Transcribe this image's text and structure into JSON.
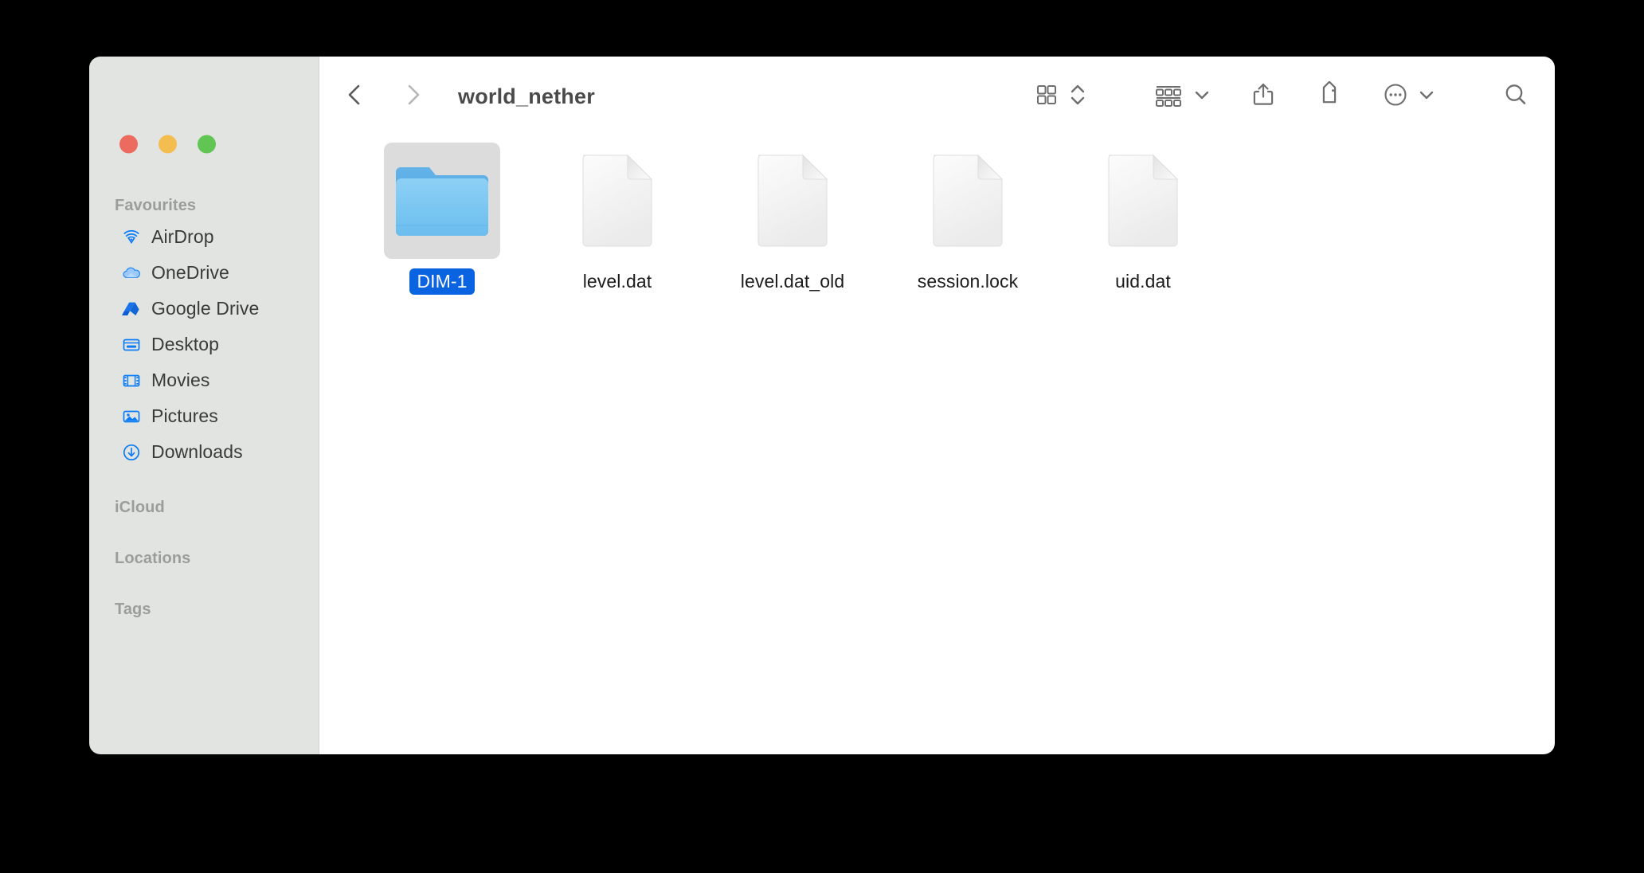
{
  "window": {
    "title": "world_nether",
    "traffic_lights": [
      {
        "name": "close",
        "color": "#ec6a5e"
      },
      {
        "name": "minimize",
        "color": "#f4bd4f"
      },
      {
        "name": "maximize",
        "color": "#61c554"
      }
    ]
  },
  "toolbar": {
    "back_icon": "chevron-left-icon",
    "forward_icon": "chevron-right-icon",
    "view_icon": "icon-view-grid-icon",
    "view_stepper_icon": "chevron-up-down-icon",
    "group_icon": "group-by-icon",
    "group_chevron_icon": "chevron-down-icon",
    "share_icon": "share-icon",
    "tag_icon": "tag-icon",
    "more_icon": "ellipsis-circle-icon",
    "more_chevron_icon": "chevron-down-icon",
    "search_icon": "search-icon"
  },
  "sidebar": {
    "sections": [
      {
        "header": "Favourites",
        "items": [
          {
            "label": "AirDrop",
            "icon": "airdrop-icon"
          },
          {
            "label": "OneDrive",
            "icon": "onedrive-cloud-icon"
          },
          {
            "label": "Google Drive",
            "icon": "google-drive-icon"
          },
          {
            "label": "Desktop",
            "icon": "desktop-icon"
          },
          {
            "label": "Movies",
            "icon": "movies-film-icon"
          },
          {
            "label": "Pictures",
            "icon": "pictures-photo-icon"
          },
          {
            "label": "Downloads",
            "icon": "downloads-arrow-icon"
          }
        ]
      },
      {
        "header": "iCloud",
        "items": []
      },
      {
        "header": "Locations",
        "items": []
      },
      {
        "header": "Tags",
        "items": []
      }
    ]
  },
  "main": {
    "files": [
      {
        "name": "DIM-1",
        "kind": "folder",
        "selected": true
      },
      {
        "name": "level.dat",
        "kind": "document",
        "selected": false
      },
      {
        "name": "level.dat_old",
        "kind": "document",
        "selected": false
      },
      {
        "name": "session.lock",
        "kind": "document",
        "selected": false
      },
      {
        "name": "uid.dat",
        "kind": "document",
        "selected": false
      }
    ]
  },
  "colors": {
    "sidebar_bg": "#e2e4e2",
    "content_bg": "#ffffff",
    "accent_blue": "#0a63e0",
    "icon_blue": "#0b7cf7",
    "selection_bg": "#dcdcdc",
    "text_primary": "#1b1b1b",
    "text_muted": "#9b9d9b"
  }
}
